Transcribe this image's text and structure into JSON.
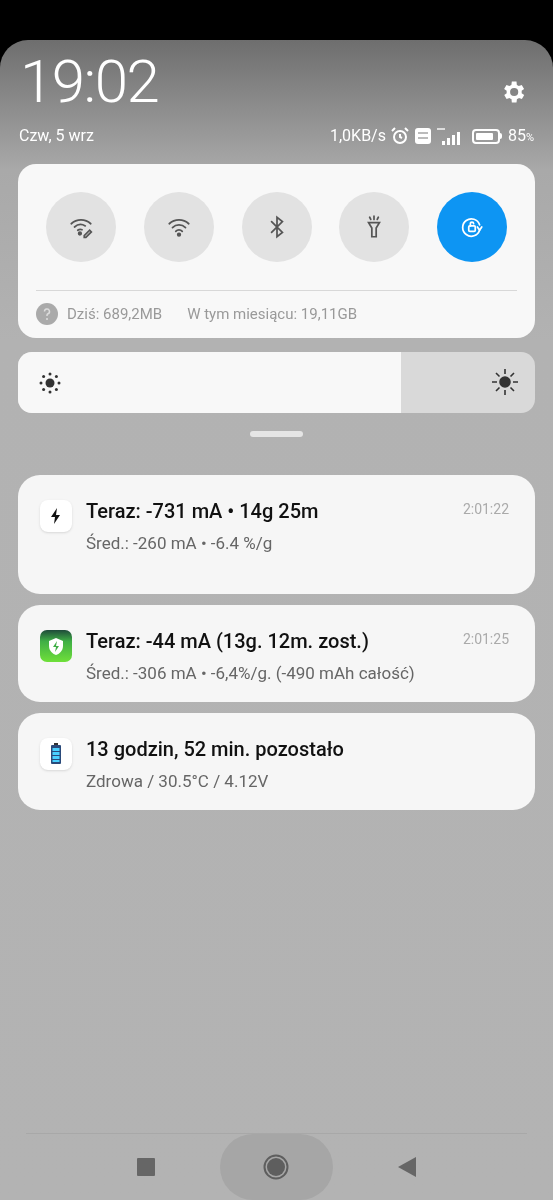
{
  "header": {
    "time": "19:02",
    "date": "Czw, 5 wrz",
    "net_speed": "1,0KB/s",
    "battery_percent": "85",
    "battery_unit": "%"
  },
  "toggles": [
    {
      "kind": "wifi-edit",
      "on": false
    },
    {
      "kind": "wifi",
      "on": false
    },
    {
      "kind": "bluetooth",
      "on": false
    },
    {
      "kind": "flashlight",
      "on": false
    },
    {
      "kind": "rotation-lock",
      "on": true
    }
  ],
  "data_usage": {
    "today": "Dziś: 689,2MB",
    "month": "W tym miesiącu: 19,11GB"
  },
  "brightness": {
    "level": 0.74
  },
  "notifications": [
    {
      "kind": "bolt",
      "title": "Teraz: -731 mA • 14g 25m",
      "text": "Śred.: -260 mA • -6.4 %/g",
      "time": "2:01:22"
    },
    {
      "kind": "shield",
      "title": "Teraz: -44 mA (13g. 12m. zost.)",
      "text": "Śred.: -306 mA • -6,4%/g. (-490 mAh całość)",
      "time": "2:01:25"
    },
    {
      "kind": "battery",
      "title": "13 godzin, 52 min. pozostało",
      "text": "Zdrowa / 30.5°C / 4.12V"
    }
  ]
}
